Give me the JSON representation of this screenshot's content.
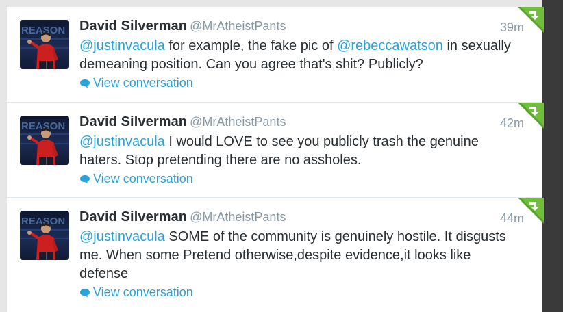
{
  "tweets": [
    {
      "name": "David Silverman",
      "handle": "@MrAtheistPants",
      "time": "39m",
      "mention": "@justinvacula",
      "text_a": " for example, the fake pic of ",
      "mention2": "@rebeccawatson",
      "text_b": " in sexually demeaning position. Can you agree that's shit? Publicly?",
      "action": "View conversation"
    },
    {
      "name": "David Silverman",
      "handle": "@MrAtheistPants",
      "time": "42m",
      "mention": "@justinvacula",
      "text_a": " I would LOVE to see you publicly trash the genuine haters. Stop pretending there are no assholes.",
      "action": "View conversation"
    },
    {
      "name": "David Silverman",
      "handle": "@MrAtheistPants",
      "time": "44m",
      "mention": "@justinvacula",
      "text_a": " SOME of the community is genuinely hostile. It disgusts me. When some Pretend otherwise,despite evidence,it looks like defense",
      "action": "View conversation"
    }
  ],
  "avatar_text": "REASON",
  "icons": {
    "conversation": "speech-bubble-icon",
    "corner": "retweet-corner-icon"
  },
  "colors": {
    "link": "#2aa3d8",
    "name": "#292f33",
    "muted": "#8899a6",
    "corner": "#5aa02c"
  }
}
